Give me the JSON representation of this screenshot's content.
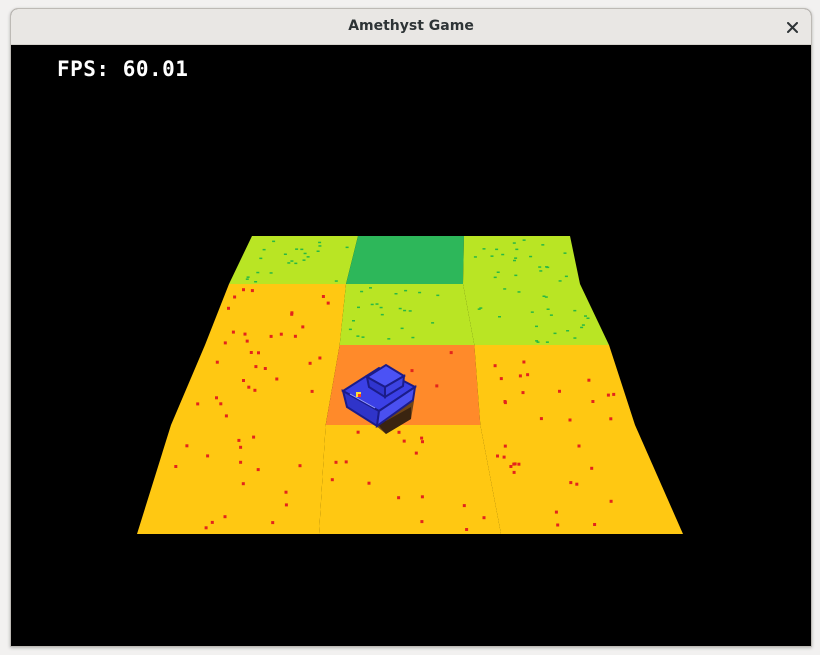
{
  "window": {
    "title": "Amethyst Game"
  },
  "hud": {
    "fps_text": "FPS: 60.01"
  },
  "colors": {
    "background": "#000000",
    "sand": "#ffc812",
    "sand_dots": "#e3241c",
    "grass": "#b9e524",
    "grass_dots": "#28b844",
    "dark_grass": "#2db75a",
    "highlight_tile": "#ff8a2a",
    "tank_body": "#3b40e6",
    "tank_edges": "#1b1c8a",
    "tank_base": "#6e4418"
  },
  "scene": {
    "board": {
      "rows": 4,
      "cols": 3
    },
    "tiles": [
      [
        "grass",
        "dark_grass",
        "grass"
      ],
      [
        "sand",
        "grass",
        "grass"
      ],
      [
        "sand",
        "highlight_tile",
        "sand"
      ],
      [
        "sand",
        "sand",
        "sand"
      ]
    ],
    "player": {
      "type": "tank",
      "row": 2,
      "col": 1
    }
  }
}
